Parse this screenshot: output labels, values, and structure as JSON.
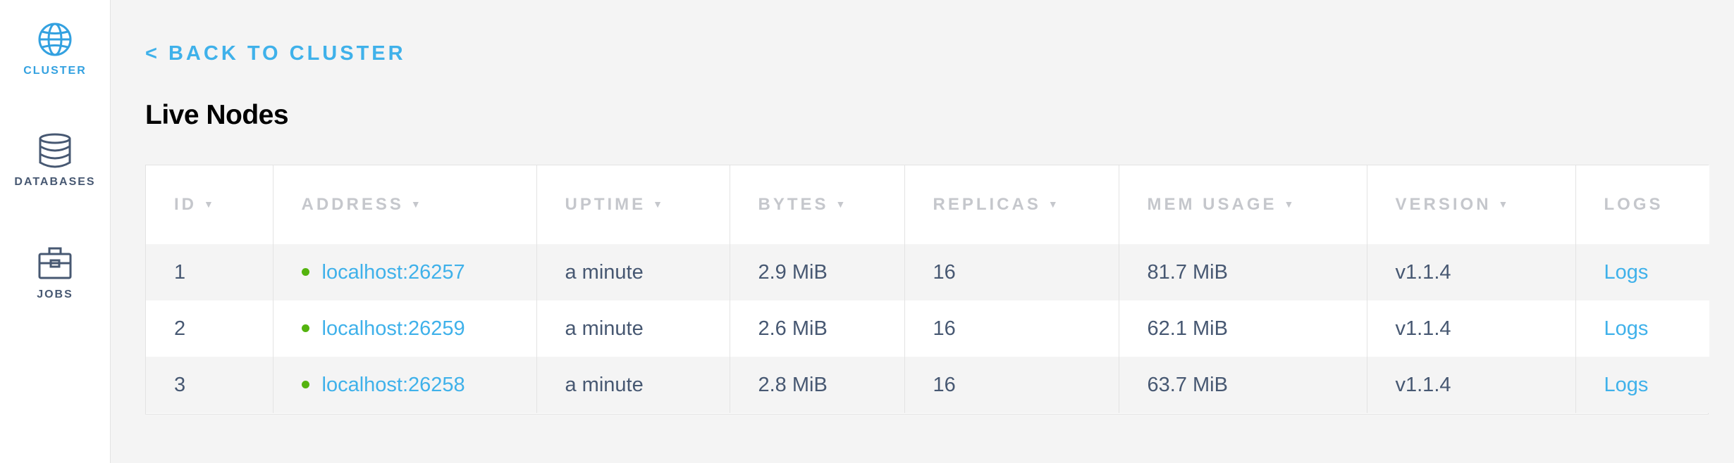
{
  "colors": {
    "accent": "#3fb1ea",
    "nav_text": "#475872",
    "header_text": "#c5c7cc",
    "status_live": "#54b30e"
  },
  "sidebar": {
    "items": [
      {
        "label": "CLUSTER",
        "icon": "globe-icon",
        "active": true
      },
      {
        "label": "DATABASES",
        "icon": "database-icon",
        "active": false
      },
      {
        "label": "JOBS",
        "icon": "briefcase-icon",
        "active": false
      }
    ]
  },
  "back_link": "< BACK TO CLUSTER",
  "page_title": "Live Nodes",
  "table": {
    "columns": [
      {
        "label": "ID",
        "sortable": true
      },
      {
        "label": "ADDRESS",
        "sortable": true
      },
      {
        "label": "UPTIME",
        "sortable": true
      },
      {
        "label": "BYTES",
        "sortable": true
      },
      {
        "label": "REPLICAS",
        "sortable": true
      },
      {
        "label": "MEM USAGE",
        "sortable": true
      },
      {
        "label": "VERSION",
        "sortable": true
      },
      {
        "label": "LOGS",
        "sortable": false
      }
    ],
    "sort_arrow": "▼",
    "rows": [
      {
        "id": "1",
        "address": "localhost:26257",
        "uptime": "a minute",
        "bytes": "2.9 MiB",
        "replicas": "16",
        "mem_usage": "81.7 MiB",
        "version": "v1.1.4",
        "logs": "Logs"
      },
      {
        "id": "2",
        "address": "localhost:26259",
        "uptime": "a minute",
        "bytes": "2.6 MiB",
        "replicas": "16",
        "mem_usage": "62.1 MiB",
        "version": "v1.1.4",
        "logs": "Logs"
      },
      {
        "id": "3",
        "address": "localhost:26258",
        "uptime": "a minute",
        "bytes": "2.8 MiB",
        "replicas": "16",
        "mem_usage": "63.7 MiB",
        "version": "v1.1.4",
        "logs": "Logs"
      }
    ]
  }
}
